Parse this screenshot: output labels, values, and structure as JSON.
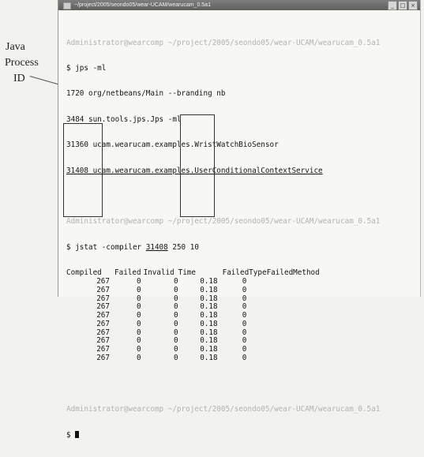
{
  "annotation": {
    "line1": "Java",
    "line2": "Process",
    "line3": "ID"
  },
  "window": {
    "title": "~/project/2005/seondo05/wear-UCAM/wearucam_0.5a1",
    "buttons": {
      "minimize": "_",
      "maximize": "□",
      "close": "×"
    }
  },
  "terminal": {
    "prompt1": "Administrator@wearcomp ~/project/2005/seondo05/wear-UCAM/wearucam_0.5a1",
    "cmd1": "$ jps -ml",
    "jps_lines": [
      "1720 org/netbeans/Main --branding nb",
      "3484 sun.tools.jps.Jps -ml",
      "31360 ucam.wearucam.examples.WristWatchBioSensor",
      "31408 ucam.wearucam.examples.UserConditionalContextService"
    ],
    "prompt2": "Administrator@wearcomp ~/project/2005/seondo05/wear-UCAM/wearucam_0.5a1",
    "cmd2_prefix": "$ jstat -compiler ",
    "cmd2_pid": "31408",
    "cmd2_suffix": " 250 10",
    "jstat_headers": [
      "Compiled",
      "Failed",
      "Invalid",
      "Time",
      "FailedType",
      "FailedMethod"
    ],
    "jstat_rows": [
      [
        "267",
        "0",
        "0",
        "0.18",
        "0",
        ""
      ],
      [
        "267",
        "0",
        "0",
        "0.18",
        "0",
        ""
      ],
      [
        "267",
        "0",
        "0",
        "0.18",
        "0",
        ""
      ],
      [
        "267",
        "0",
        "0",
        "0.18",
        "0",
        ""
      ],
      [
        "267",
        "0",
        "0",
        "0.18",
        "0",
        ""
      ],
      [
        "267",
        "0",
        "0",
        "0.18",
        "0",
        ""
      ],
      [
        "267",
        "0",
        "0",
        "0.18",
        "0",
        ""
      ],
      [
        "267",
        "0",
        "0",
        "0.18",
        "0",
        ""
      ],
      [
        "267",
        "0",
        "0",
        "0.18",
        "0",
        ""
      ],
      [
        "267",
        "0",
        "0",
        "0.18",
        "0",
        ""
      ]
    ],
    "prompt3": "Administrator@wearcomp ~/project/2005/seondo05/wear-UCAM/wearucam_0.5a1",
    "cmd3": "$ "
  }
}
